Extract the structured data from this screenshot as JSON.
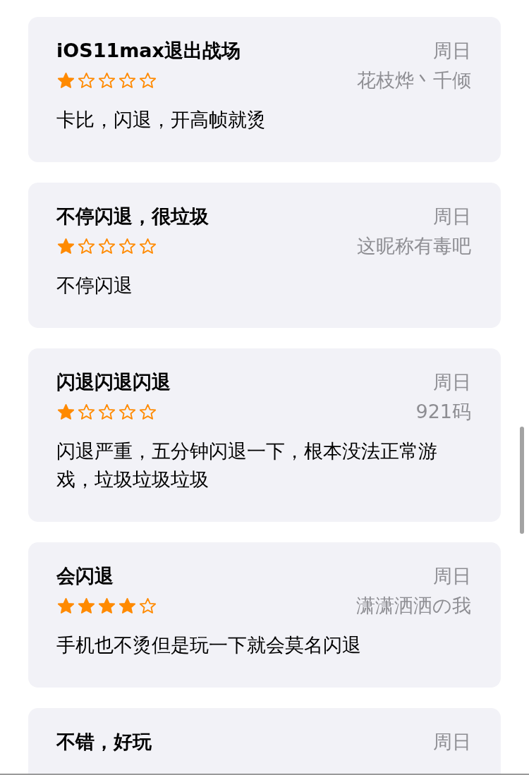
{
  "reviews": [
    {
      "title": "iOS11max退出战场",
      "date": "周日",
      "stars": 1,
      "author": "花枝烨丶千倾",
      "body": "卡比，闪退，开高帧就烫"
    },
    {
      "title": "不停闪退，很垃圾",
      "date": "周日",
      "stars": 1,
      "author": "这昵称有毒吧",
      "body": "不停闪退"
    },
    {
      "title": "闪退闪退闪退",
      "date": "周日",
      "stars": 1,
      "author": "921码",
      "body": "闪退严重，五分钟闪退一下，根本没法正常游戏，垃圾垃圾垃圾"
    },
    {
      "title": "会闪退",
      "date": "周日",
      "stars": 4,
      "author": "潇潇洒洒の我",
      "body": "手机也不烫但是玩一下就会莫名闪退"
    },
    {
      "title": "不错，好玩",
      "date": "周日"
    }
  ]
}
